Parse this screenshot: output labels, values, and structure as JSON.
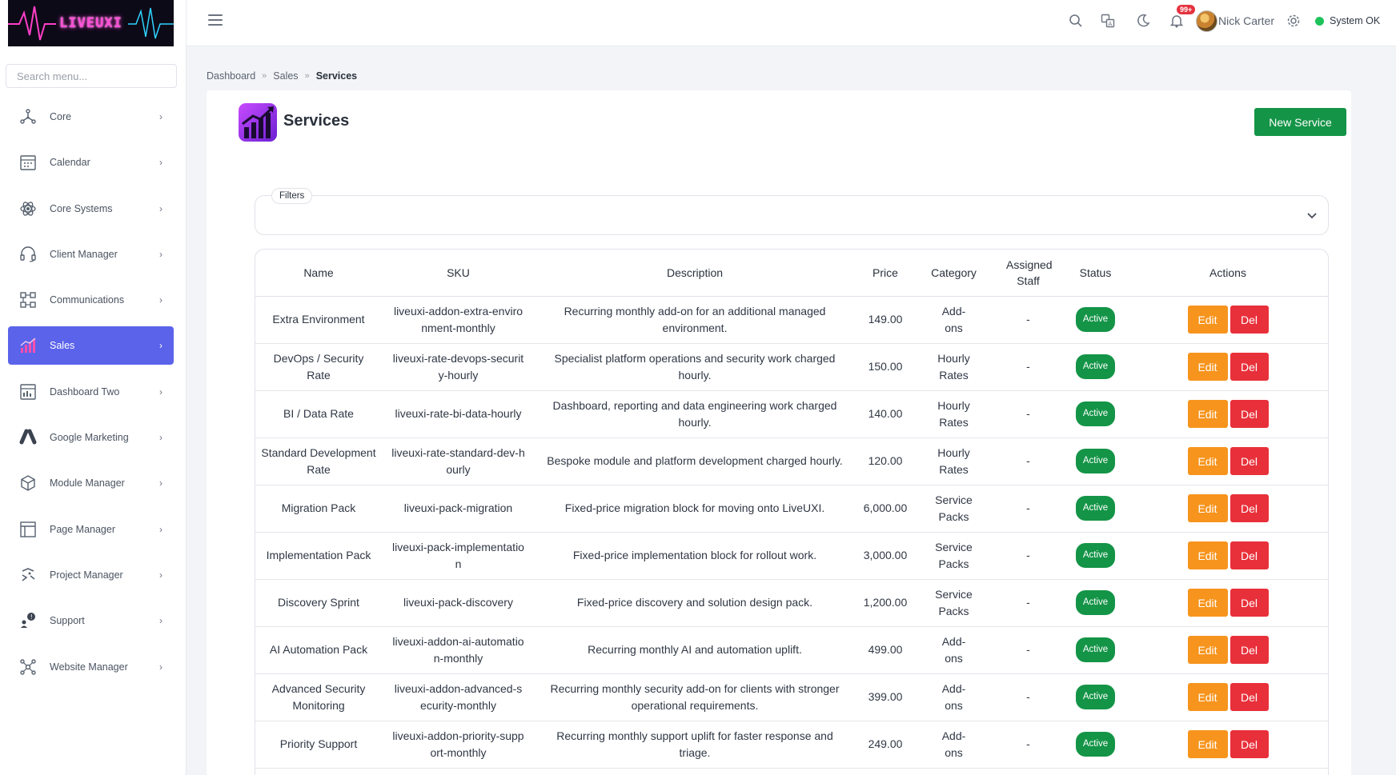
{
  "app": {
    "logo_text": "LIVEUXI"
  },
  "sidebar": {
    "search_placeholder": "Search menu...",
    "items": [
      {
        "label": "Core",
        "icon": "network-icon",
        "active": false
      },
      {
        "label": "Calendar",
        "icon": "calendar-icon",
        "active": false
      },
      {
        "label": "Core Systems",
        "icon": "atom-icon",
        "active": false
      },
      {
        "label": "Client Manager",
        "icon": "headset-icon",
        "active": false
      },
      {
        "label": "Communications",
        "icon": "nodes-icon",
        "active": false
      },
      {
        "label": "Sales",
        "icon": "bar-chart-icon",
        "active": true
      },
      {
        "label": "Dashboard Two",
        "icon": "dashboard-icon",
        "active": false
      },
      {
        "label": "Google Marketing",
        "icon": "google-ads-icon",
        "active": false
      },
      {
        "label": "Module Manager",
        "icon": "cube-icon",
        "active": false
      },
      {
        "label": "Page Manager",
        "icon": "layout-icon",
        "active": false
      },
      {
        "label": "Project Manager",
        "icon": "project-icon",
        "active": false
      },
      {
        "label": "Support",
        "icon": "support-icon",
        "active": false
      },
      {
        "label": "Website Manager",
        "icon": "molecule-icon",
        "active": false
      }
    ]
  },
  "topbar": {
    "notifications_count": "99+",
    "user_name": "Nick Carter",
    "system_status": "System OK",
    "status_color": "#1ec25a"
  },
  "breadcrumb": {
    "items": [
      "Dashboard",
      "Sales"
    ],
    "current": "Services"
  },
  "page": {
    "title": "Services",
    "new_button": "New Service",
    "filters_label": "Filters"
  },
  "table": {
    "columns": [
      "Name",
      "SKU",
      "Description",
      "Price",
      "Category",
      "Assigned Staff",
      "Status",
      "Actions"
    ],
    "rows": [
      {
        "name": "Extra Environment",
        "sku": "liveuxi-addon-extra-environment-monthly",
        "description": "Recurring monthly add-on for an additional managed environment.",
        "price": "149.00",
        "category": "Add-ons",
        "staff": "-",
        "status": "Active"
      },
      {
        "name": "DevOps / Security Rate",
        "sku": "liveuxi-rate-devops-security-hourly",
        "description": "Specialist platform operations and security work charged hourly.",
        "price": "150.00",
        "category": "Hourly Rates",
        "staff": "-",
        "status": "Active"
      },
      {
        "name": "BI / Data Rate",
        "sku": "liveuxi-rate-bi-data-hourly",
        "description": "Dashboard, reporting and data engineering work charged hourly.",
        "price": "140.00",
        "category": "Hourly Rates",
        "staff": "-",
        "status": "Active"
      },
      {
        "name": "Standard Development Rate",
        "sku": "liveuxi-rate-standard-dev-hourly",
        "description": "Bespoke module and platform development charged hourly.",
        "price": "120.00",
        "category": "Hourly Rates",
        "staff": "-",
        "status": "Active"
      },
      {
        "name": "Migration Pack",
        "sku": "liveuxi-pack-migration",
        "description": "Fixed-price migration block for moving onto LiveUXI.",
        "price": "6,000.00",
        "category": "Service Packs",
        "staff": "-",
        "status": "Active"
      },
      {
        "name": "Implementation Pack",
        "sku": "liveuxi-pack-implementation",
        "description": "Fixed-price implementation block for rollout work.",
        "price": "3,000.00",
        "category": "Service Packs",
        "staff": "-",
        "status": "Active"
      },
      {
        "name": "Discovery Sprint",
        "sku": "liveuxi-pack-discovery",
        "description": "Fixed-price discovery and solution design pack.",
        "price": "1,200.00",
        "category": "Service Packs",
        "staff": "-",
        "status": "Active"
      },
      {
        "name": "AI Automation Pack",
        "sku": "liveuxi-addon-ai-automation-monthly",
        "description": "Recurring monthly AI and automation uplift.",
        "price": "499.00",
        "category": "Add-ons",
        "staff": "-",
        "status": "Active"
      },
      {
        "name": "Advanced Security Monitoring",
        "sku": "liveuxi-addon-advanced-security-monthly",
        "description": "Recurring monthly security add-on for clients with stronger operational requirements.",
        "price": "399.00",
        "category": "Add-ons",
        "staff": "-",
        "status": "Active"
      },
      {
        "name": "Priority Support",
        "sku": "liveuxi-addon-priority-support-monthly",
        "description": "Recurring monthly support uplift for faster response and triage.",
        "price": "249.00",
        "category": "Add-ons",
        "staff": "-",
        "status": "Active"
      }
    ],
    "edit_label": "Edit",
    "delete_label": "Del"
  },
  "colors": {
    "accent": "#5b63ea",
    "success": "#149447",
    "warning": "#f7941d",
    "danger": "#e8303a"
  }
}
